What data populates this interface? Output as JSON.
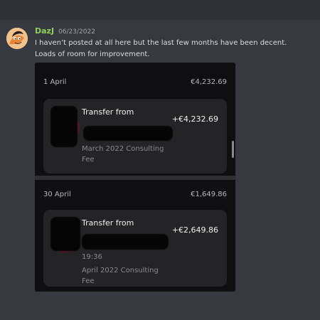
{
  "message": {
    "username": "DazJ",
    "timestamp": "06/23/2022",
    "lines": [
      "I haven’t posted at all here but the last few months have been decent.",
      "Loads of room for improvement."
    ]
  },
  "attachment": {
    "transactions": [
      {
        "date": "1 April",
        "balance": "€4,232.69",
        "title": "Transfer from",
        "amount": "+€4,232.69",
        "description_lines": [
          "March 2022 Consulting",
          "Fee"
        ]
      },
      {
        "date": "30 April",
        "balance": "€1,649.86",
        "title": "Transfer from",
        "amount": "+€2,649.86",
        "time": "19:36",
        "description_lines": [
          "April 2022 Consulting",
          "Fee"
        ]
      }
    ]
  },
  "colors": {
    "background": "#36393f",
    "username": "#8ccf5a",
    "message_text": "#dcddde",
    "timestamp": "#a3a6aa",
    "bank_background": "#0f0f11",
    "card_background": "#242426",
    "secondary_text": "#8a8a8e"
  },
  "icons": {
    "avatar": "cartoon-avatar-icon",
    "merchant_logo": "merchant-logo-icon",
    "scrollbar": "scroll-thumb"
  }
}
